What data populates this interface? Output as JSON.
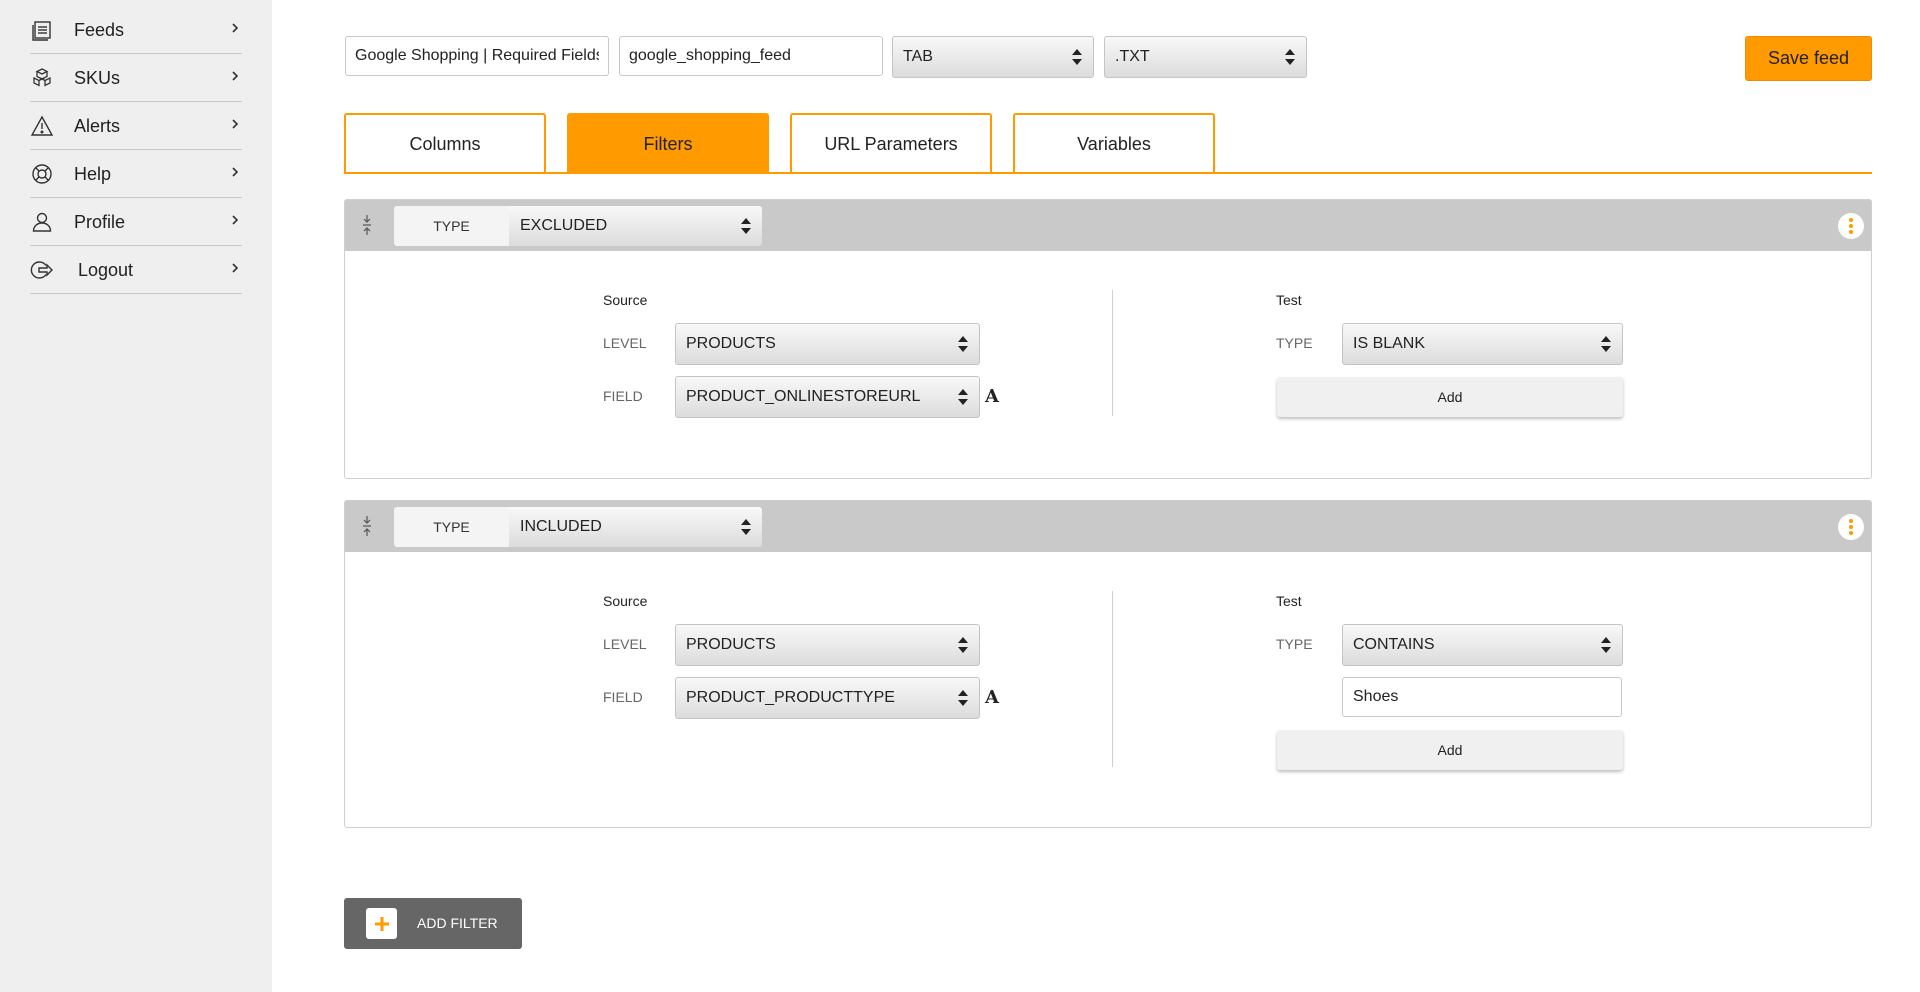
{
  "sidebar": {
    "items": [
      {
        "label": "Feeds",
        "icon": "feeds-icon"
      },
      {
        "label": "SKUs",
        "icon": "skus-icon"
      },
      {
        "label": "Alerts",
        "icon": "alert-icon"
      },
      {
        "label": "Help",
        "icon": "help-icon"
      },
      {
        "label": "Profile",
        "icon": "profile-icon"
      },
      {
        "label": "Logout",
        "icon": "logout-icon"
      }
    ]
  },
  "toolbar": {
    "feed_name": "Google Shopping | Required Fields",
    "feed_file": "google_shopping_feed",
    "delimiter": "TAB",
    "extension": ".TXT",
    "save_label": "Save feed"
  },
  "tabs": [
    {
      "label": "Columns",
      "active": false
    },
    {
      "label": "Filters",
      "active": true
    },
    {
      "label": "URL Parameters",
      "active": false
    },
    {
      "label": "Variables",
      "active": false
    }
  ],
  "filters": [
    {
      "type_label": "TYPE",
      "type_value": "EXCLUDED",
      "source": {
        "title": "Source",
        "level_label": "LEVEL",
        "level_value": "PRODUCTS",
        "field_label": "FIELD",
        "field_value": "PRODUCT_ONLINESTOREURL",
        "field_icon": "A"
      },
      "test": {
        "title": "Test",
        "type_label": "TYPE",
        "type_value": "IS BLANK",
        "add_label": "Add"
      }
    },
    {
      "type_label": "TYPE",
      "type_value": "INCLUDED",
      "source": {
        "title": "Source",
        "level_label": "LEVEL",
        "level_value": "PRODUCTS",
        "field_label": "FIELD",
        "field_value": "PRODUCT_PRODUCTTYPE",
        "field_icon": "A"
      },
      "test": {
        "title": "Test",
        "type_label": "TYPE",
        "type_value": "CONTAINS",
        "value": "Shoes",
        "add_label": "Add"
      }
    }
  ],
  "add_filter_label": "ADD FILTER",
  "colors": {
    "accent": "#ff9a00",
    "sidebar_bg": "#efefef",
    "filter_header_bg": "#c9c9c9",
    "add_filter_bg": "#666666"
  }
}
